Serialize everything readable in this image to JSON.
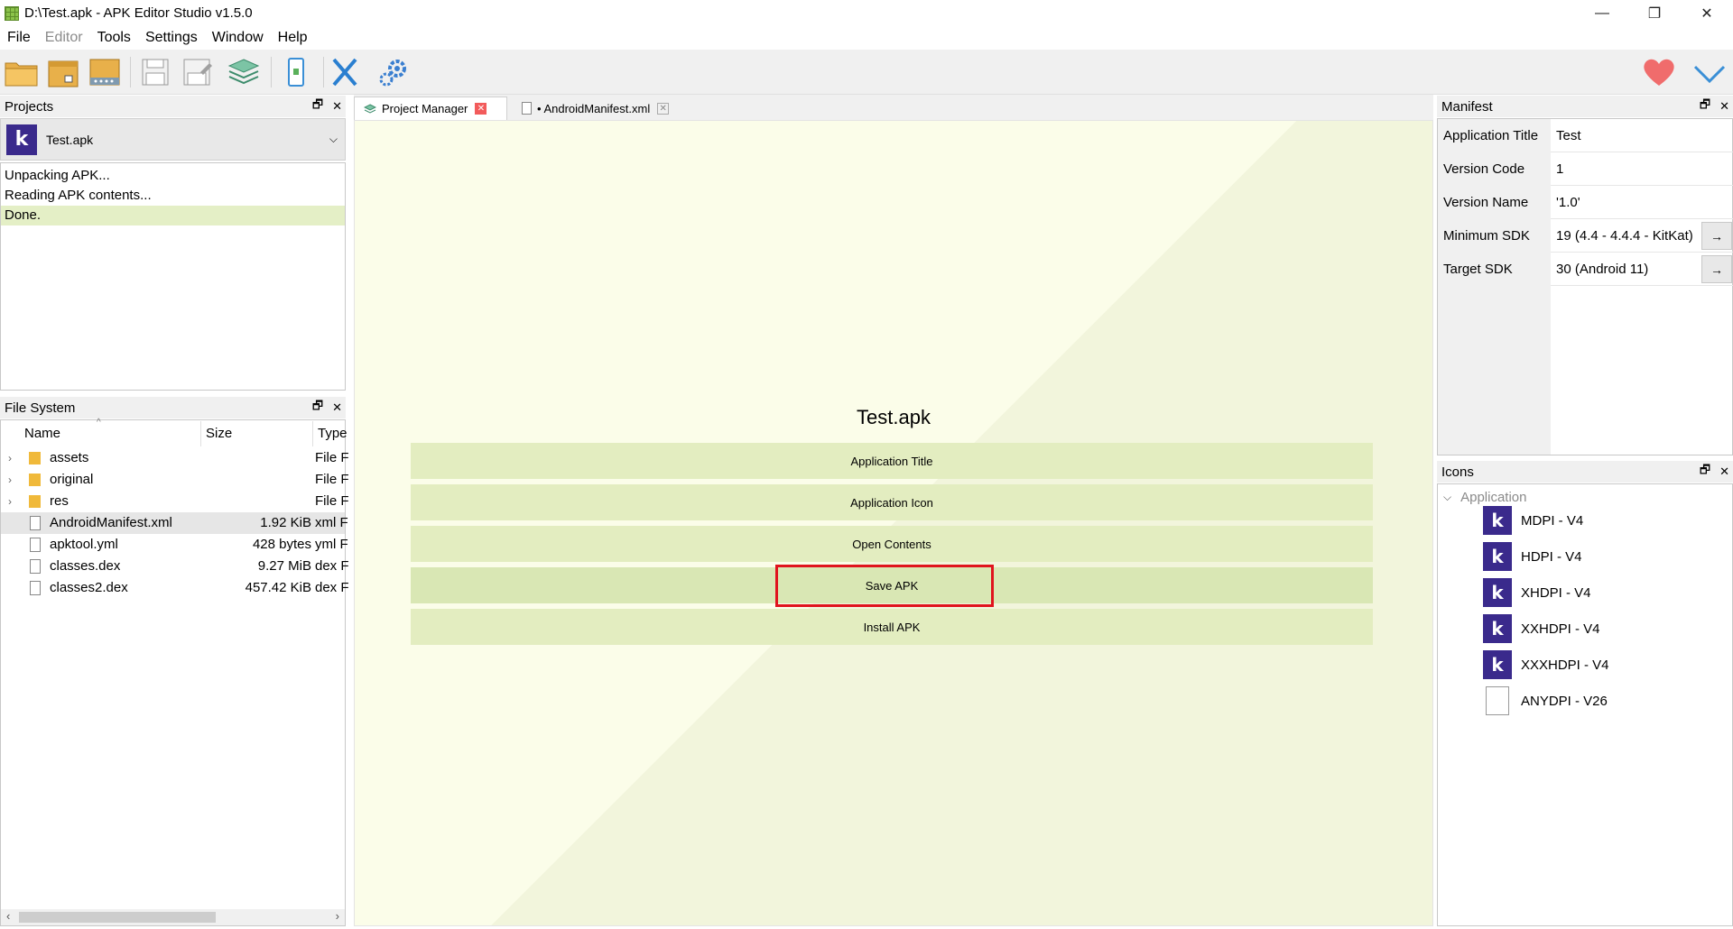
{
  "window": {
    "title": "D:\\Test.apk - APK Editor Studio v1.5.0",
    "minimize": "—",
    "maximize": "❐",
    "close": "✕"
  },
  "menu": [
    "File",
    "Editor",
    "Tools",
    "Settings",
    "Window",
    "Help"
  ],
  "toolbar": {
    "icons": [
      "open-apk-icon",
      "open-project-icon",
      "archive-icon",
      "save-icon",
      "save-as-icon",
      "project-manager-icon",
      "device-icon",
      "close-apk-icon",
      "settings-icon",
      "donate-heart-icon",
      "update-check-icon"
    ]
  },
  "projects": {
    "title": "Projects",
    "selected": "Test.apk",
    "log": [
      "Unpacking APK...",
      "Reading APK contents...",
      "Done."
    ]
  },
  "filesystem": {
    "title": "File System",
    "columns": [
      "Name",
      "Size",
      "Type"
    ],
    "rows": [
      {
        "name": "assets",
        "size": "",
        "type": "File F",
        "kind": "folder"
      },
      {
        "name": "original",
        "size": "",
        "type": "File F",
        "kind": "folder"
      },
      {
        "name": "res",
        "size": "",
        "type": "File F",
        "kind": "folder"
      },
      {
        "name": "AndroidManifest.xml",
        "size": "1.92 KiB",
        "type": "xml F",
        "kind": "file"
      },
      {
        "name": "apktool.yml",
        "size": "428 bytes",
        "type": "yml F",
        "kind": "file"
      },
      {
        "name": "classes.dex",
        "size": "9.27 MiB",
        "type": "dex F",
        "kind": "file"
      },
      {
        "name": "classes2.dex",
        "size": "457.42 KiB",
        "type": "dex F",
        "kind": "file"
      }
    ]
  },
  "tabs": [
    {
      "label": "Project Manager"
    },
    {
      "label": "• AndroidManifest.xml"
    }
  ],
  "project_manager": {
    "title": "Test.apk",
    "buttons": [
      "Application Title",
      "Application Icon",
      "Open Contents",
      "Save APK",
      "Install APK"
    ]
  },
  "manifest": {
    "title": "Manifest",
    "rows": [
      {
        "key": "Application Title",
        "value": "Test"
      },
      {
        "key": "Version Code",
        "value": "1"
      },
      {
        "key": "Version Name",
        "value": "'1.0'"
      },
      {
        "key": "Minimum SDK",
        "value": "19 (4.4 - 4.4.4 - KitKat)"
      },
      {
        "key": "Target SDK",
        "value": "30 (Android 11)"
      }
    ],
    "arrow": "→"
  },
  "icons_panel": {
    "title": "Icons",
    "group": "Application",
    "items": [
      "MDPI - V4",
      "HDPI - V4",
      "XHDPI - V4",
      "XXHDPI - V4",
      "XXXHDPI - V4",
      "ANYDPI - V26"
    ]
  },
  "colors": {
    "accent_highlight": "#e0141e",
    "button_bg": "#e3edc0",
    "brand_k": "#3a2a8c"
  }
}
